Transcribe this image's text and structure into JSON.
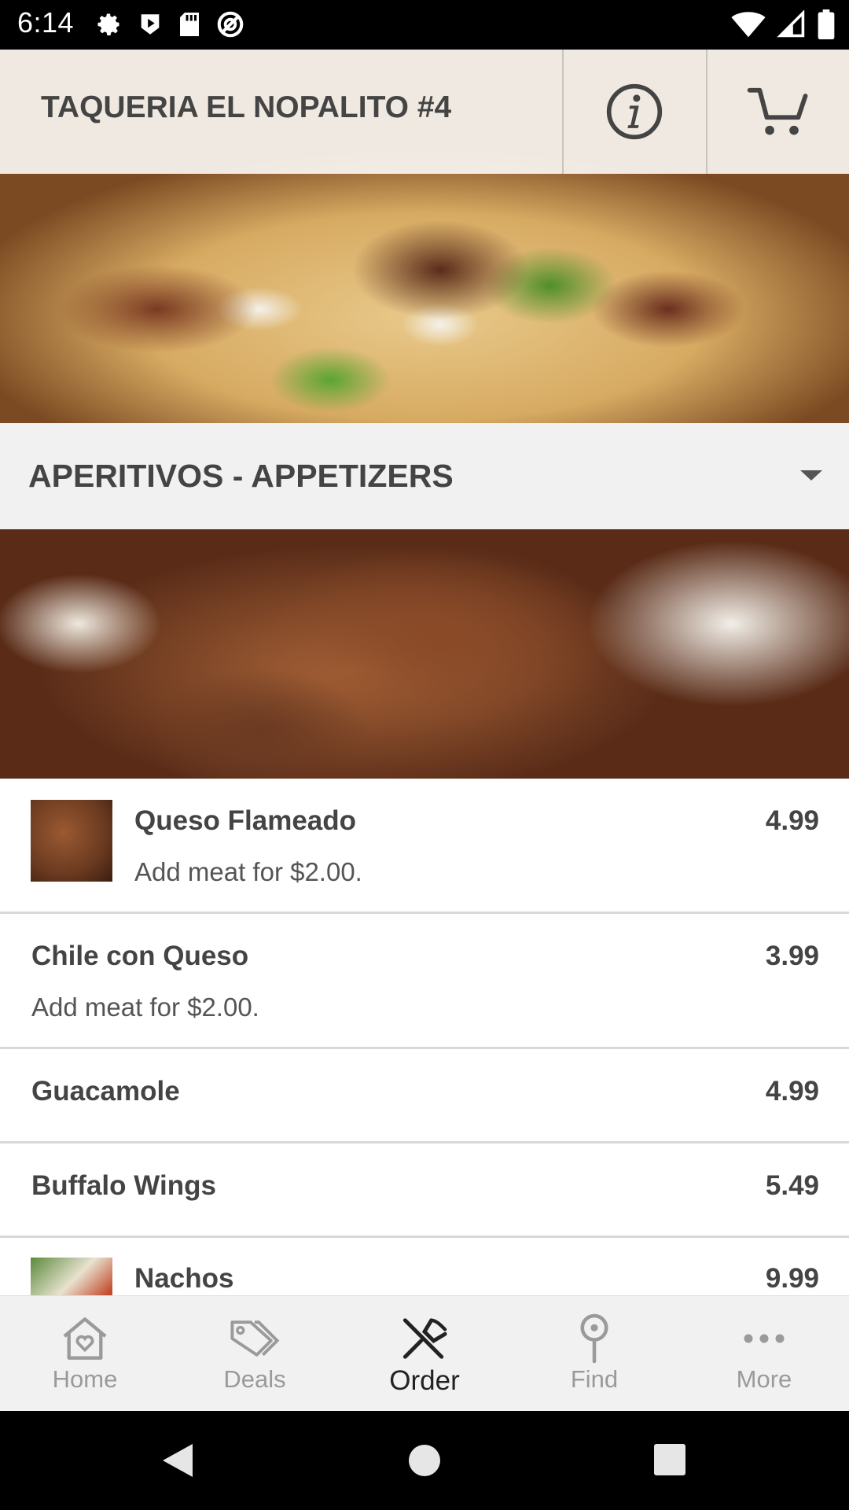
{
  "status_bar": {
    "time": "6:14",
    "left_icons": [
      "settings-icon",
      "play-store-icon",
      "sd-card-icon",
      "blocked-icon"
    ],
    "right_icons": [
      "wifi-icon",
      "cellular-signal-icon",
      "battery-icon"
    ]
  },
  "header": {
    "title": "TAQUERIA EL NOPALITO #4",
    "info_icon": "info-icon",
    "cart_icon": "cart-icon"
  },
  "category": {
    "label": "APERITIVOS - APPETIZERS",
    "caret_icon": "dropdown-caret-icon"
  },
  "menu_items": [
    {
      "name": "Queso Flameado",
      "desc": "Add meat for $2.00.",
      "price": "4.99",
      "has_thumb": true
    },
    {
      "name": "Chile con Queso",
      "desc": "Add meat for $2.00.",
      "price": "3.99",
      "has_thumb": false
    },
    {
      "name": "Guacamole",
      "desc": "",
      "price": "4.99",
      "has_thumb": false
    },
    {
      "name": "Buffalo Wings",
      "desc": "",
      "price": "5.49",
      "has_thumb": false
    },
    {
      "name": "Nachos",
      "desc": "",
      "price": "9.99",
      "has_thumb": true
    }
  ],
  "tab_bar": {
    "tabs": [
      {
        "label": "Home",
        "icon": "home-icon",
        "active": false
      },
      {
        "label": "Deals",
        "icon": "tag-icon",
        "active": false
      },
      {
        "label": "Order",
        "icon": "utensils-icon",
        "active": true
      },
      {
        "label": "Find",
        "icon": "location-pin-icon",
        "active": false
      },
      {
        "label": "More",
        "icon": "more-dots-icon",
        "active": false
      }
    ]
  },
  "nav_bar": {
    "icons": [
      "back-icon",
      "home-circle-icon",
      "recents-icon"
    ]
  },
  "colors": {
    "header_text": "#444444",
    "tab_inactive": "#9a9a9a",
    "tab_active": "#222222",
    "divider": "#d8d8d8"
  }
}
